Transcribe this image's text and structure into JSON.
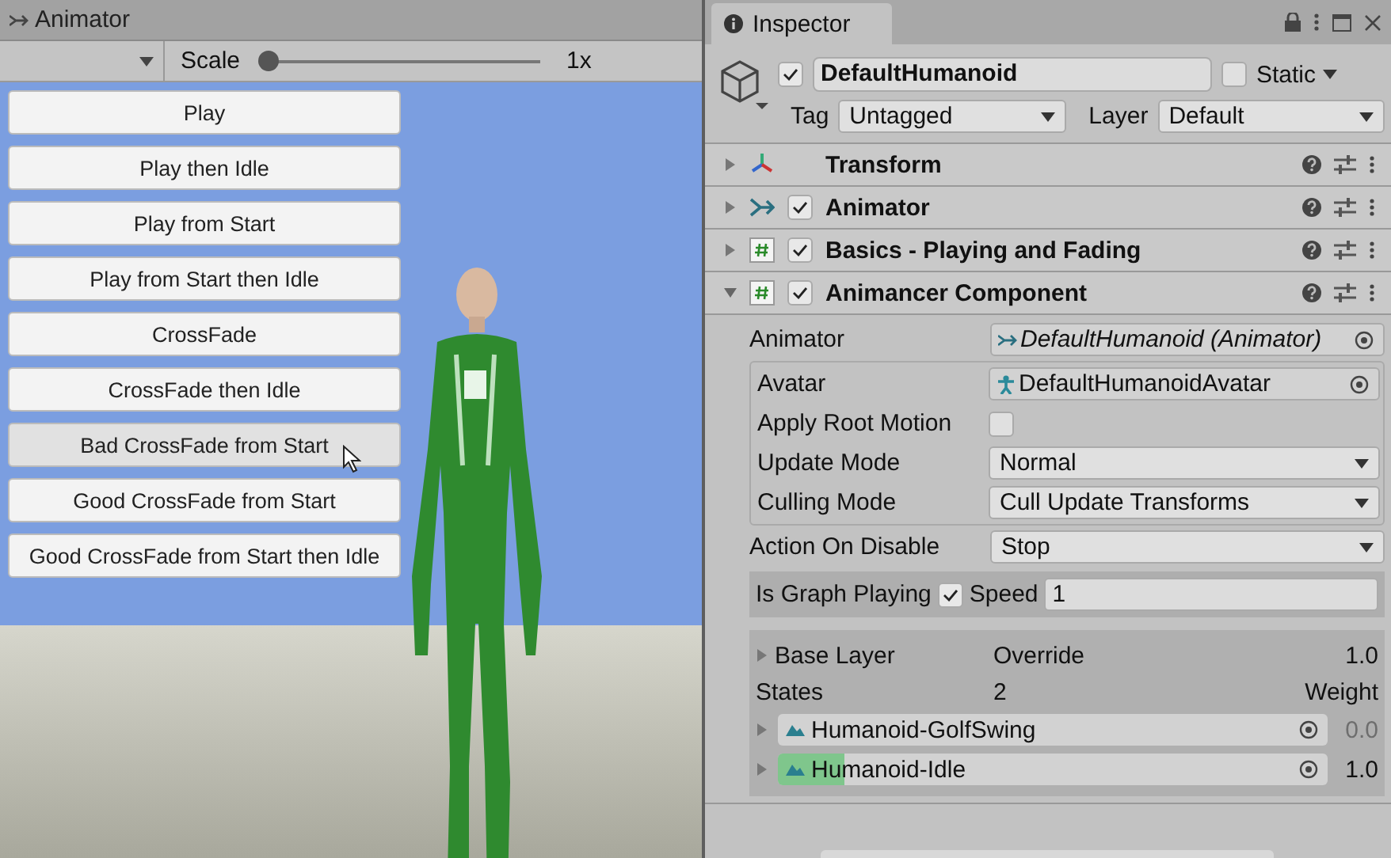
{
  "animator_window": {
    "title": "Animator",
    "toolbar": {
      "scale_label": "Scale",
      "scale": {
        "level": 0.0
      },
      "scale_value": "1x"
    },
    "buttons": [
      {
        "label": "Play",
        "hovered": false
      },
      {
        "label": "Play then Idle",
        "hovered": false
      },
      {
        "label": "Play from Start",
        "hovered": false
      },
      {
        "label": "Play from Start then Idle",
        "hovered": false
      },
      {
        "label": "CrossFade",
        "hovered": false
      },
      {
        "label": "CrossFade then Idle",
        "hovered": false
      },
      {
        "label": "Bad CrossFade from Start",
        "hovered": true
      },
      {
        "label": "Good CrossFade from Start",
        "hovered": false
      },
      {
        "label": "Good CrossFade from Start then Idle",
        "hovered": false
      }
    ]
  },
  "inspector": {
    "tab": "Inspector",
    "object": {
      "active": true,
      "name": "DefaultHumanoid",
      "static": false,
      "static_label": "Static",
      "tag_label": "Tag",
      "tag": "Untagged",
      "layer_label": "Layer",
      "layer": "Default"
    },
    "components": [
      {
        "kind": "transform",
        "name": "Transform",
        "expanded": false
      },
      {
        "kind": "animator",
        "name": "Animator",
        "expanded": false,
        "enabled": true
      },
      {
        "kind": "script",
        "name": "Basics - Playing and Fading",
        "expanded": false,
        "enabled": true
      },
      {
        "kind": "script",
        "name": "Animancer Component",
        "expanded": true,
        "enabled": true
      }
    ],
    "animancer": {
      "animator": {
        "label": "Animator",
        "value": "DefaultHumanoid (Animator)"
      },
      "settings": [
        {
          "kind": "object",
          "label": "Avatar",
          "value": "DefaultHumanoidAvatar"
        },
        {
          "kind": "checkbox",
          "label": "Apply Root Motion",
          "checked": false
        },
        {
          "kind": "dropdown",
          "label": "Update Mode",
          "value": "Normal"
        },
        {
          "kind": "dropdown",
          "label": "Culling Mode",
          "value": "Cull Update Transforms"
        }
      ],
      "action_on_disable": {
        "label": "Action On Disable",
        "value": "Stop"
      },
      "graph": {
        "playing_label": "Is Graph Playing",
        "playing": true,
        "speed_label": "Speed",
        "speed": "1"
      },
      "layer": {
        "name": "Base Layer",
        "expanded": false,
        "mode": "Override",
        "weight": "1.0",
        "states_label": "States",
        "states_count": "2",
        "weight_label": "Weight"
      },
      "states": [
        {
          "name": "Humanoid-GolfSwing",
          "level": 0.0,
          "weight": "0.0",
          "active": false
        },
        {
          "name": "Humanoid-Idle",
          "level": 0.12,
          "weight": "1.0",
          "active": true
        }
      ]
    }
  }
}
